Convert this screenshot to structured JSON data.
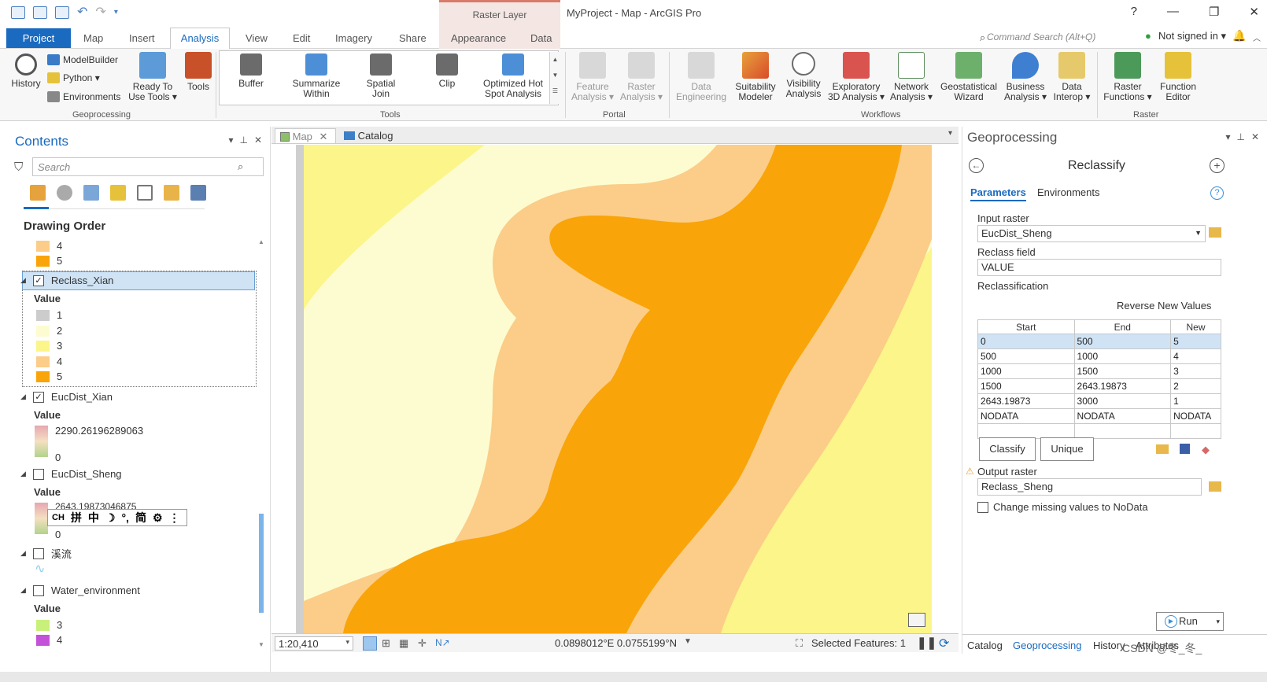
{
  "window": {
    "title": "MyProject - Map - ArcGIS Pro",
    "ctx_group": "Raster Layer",
    "controls": [
      "?",
      "—",
      "❐",
      "✕"
    ]
  },
  "tabs": {
    "project": "Project",
    "map": "Map",
    "insert": "Insert",
    "analysis": "Analysis",
    "view": "View",
    "edit": "Edit",
    "imagery": "Imagery",
    "share": "Share",
    "appearance": "Appearance",
    "data": "Data"
  },
  "search": {
    "placeholder": "Command Search (Alt+Q)"
  },
  "account": {
    "signin": "Not signed in ▾"
  },
  "ribbon": {
    "geoprocessing": {
      "history": "History",
      "modelbuilder": "ModelBuilder",
      "python": "Python ▾",
      "environments": "Environments",
      "ready_to_use_1": "Ready To",
      "ready_to_use_2": "Use Tools ▾",
      "tools": "Tools",
      "label": "Geoprocessing"
    },
    "tools": {
      "buffer": "Buffer",
      "summarize_1": "Summarize",
      "summarize_2": "Within",
      "spatial_join_1": "Spatial",
      "spatial_join_2": "Join",
      "clip": "Clip",
      "hot_spot_1": "Optimized Hot",
      "hot_spot_2": "Spot Analysis",
      "label": "Tools"
    },
    "portal": {
      "feature_1": "Feature",
      "feature_2": "Analysis ▾",
      "raster_1": "Raster",
      "raster_2": "Analysis ▾",
      "label": "Portal"
    },
    "workflows": {
      "data_eng_1": "Data",
      "data_eng_2": "Engineering",
      "suit_1": "Suitability",
      "suit_2": "Modeler",
      "vis_1": "Visibility",
      "vis_2": "Analysis",
      "expl_1": "Exploratory",
      "expl_2": "3D Analysis ▾",
      "net_1": "Network",
      "net_2": "Analysis ▾",
      "geostat_1": "Geostatistical",
      "geostat_2": "Wizard",
      "bus_1": "Business",
      "bus_2": "Analysis ▾",
      "interop_1": "Data",
      "interop_2": "Interop ▾",
      "label": "Workflows"
    },
    "raster": {
      "rf_1": "Raster",
      "rf_2": "Functions ▾",
      "fe_1": "Function",
      "fe_2": "Editor",
      "label": "Raster"
    }
  },
  "contents": {
    "title": "Contents",
    "search_placeholder": "Search",
    "drawing_order": "Drawing Order",
    "value_label": "Value",
    "top_classes": [
      {
        "label": "4",
        "color": "#fbcd88"
      },
      {
        "label": "5",
        "color": "#f9a408"
      }
    ],
    "reclass_xian": {
      "name": "Reclass_Xian",
      "classes": [
        {
          "label": "1",
          "color": "#cccccc"
        },
        {
          "label": "2",
          "color": "#fdfcd0"
        },
        {
          "label": "3",
          "color": "#fcf589"
        },
        {
          "label": "4",
          "color": "#fbcd88"
        },
        {
          "label": "5",
          "color": "#f9a408"
        }
      ]
    },
    "eucdist_xian": {
      "name": "EucDist_Xian",
      "max": "2290.26196289063",
      "min": "0"
    },
    "eucdist_sheng": {
      "name": "EucDist_Sheng",
      "max": "2643.19873046875",
      "min": "0"
    },
    "xiliu": {
      "name": "溪流"
    },
    "water_env": {
      "name": "Water_environment",
      "classes": [
        {
          "label": "3",
          "color": "#c8f07a"
        },
        {
          "label": "4",
          "color": "#c452d8"
        }
      ]
    },
    "ime_bar": [
      "CH",
      "拼",
      "中",
      "☽",
      "°,",
      "简",
      "⚙",
      "⋮"
    ]
  },
  "view": {
    "map_tab": "Map",
    "catalog_tab": "Catalog",
    "scale": "1:20,410",
    "coords": "0.0898012°E 0.0755199°N",
    "selected": "Selected Features: 1"
  },
  "geoprocessing": {
    "title": "Geoprocessing",
    "tool": "Reclassify",
    "tab_params": "Parameters",
    "tab_envs": "Environments",
    "input_raster_label": "Input raster",
    "input_raster": "EucDist_Sheng",
    "reclass_field_label": "Reclass field",
    "reclass_field": "VALUE",
    "reclassification_label": "Reclassification",
    "reverse": "Reverse New Values",
    "table_headers": [
      "Start",
      "End",
      "New"
    ],
    "table_rows": [
      [
        "0",
        "500",
        "5"
      ],
      [
        "500",
        "1000",
        "4"
      ],
      [
        "1000",
        "1500",
        "3"
      ],
      [
        "1500",
        "2643.19873",
        "2"
      ],
      [
        "2643.19873",
        "3000",
        "1"
      ],
      [
        "NODATA",
        "NODATA",
        "NODATA"
      ],
      [
        "",
        "",
        ""
      ]
    ],
    "classify": "Classify",
    "unique": "Unique",
    "output_raster_label": "Output raster",
    "output_raster": "Reclass_Sheng",
    "change_missing": "Change missing values to NoData",
    "run": "Run",
    "bottom_tabs": {
      "catalog": "Catalog",
      "geoprocessing": "Geoprocessing",
      "history": "History",
      "attributes": "Attributes"
    }
  },
  "watermark": "CSDN @冬_冬_",
  "colors": {
    "accent": "#1a6ac0",
    "class1": "#cccccc",
    "class2": "#fdfcd0",
    "class3": "#fcf589",
    "class4": "#fbcd88",
    "class5": "#f9a408"
  }
}
